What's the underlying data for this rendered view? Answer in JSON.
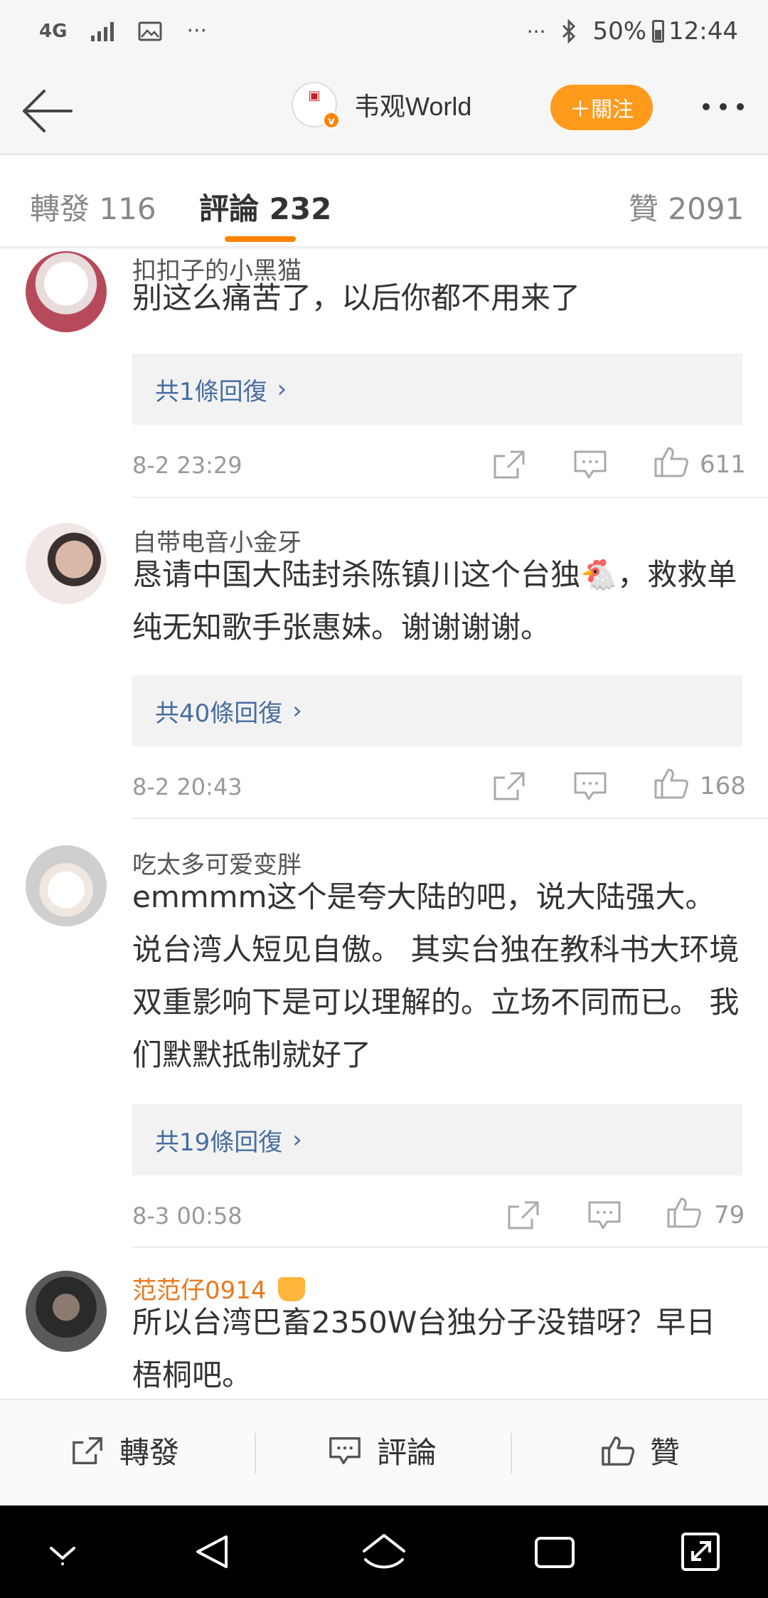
{
  "status_bar": {
    "network": "4G",
    "battery": "50%",
    "time": "12:44",
    "more_left": "···",
    "more_right": "···"
  },
  "header": {
    "account_name": "韦观World",
    "follow_label": "＋關注"
  },
  "tabs": [
    {
      "label": "轉發",
      "count": "116"
    },
    {
      "label": "評論",
      "count": "232"
    },
    {
      "label": "贊",
      "count": "2091"
    }
  ],
  "comments": [
    {
      "user": "扣扣子的小黑猫",
      "text": "别这么痛苦了，以后你都不用来了",
      "replies": "共1條回復",
      "time": "8-2 23:29",
      "likes": "611"
    },
    {
      "user": "自带电音小金牙",
      "text": "恳请中国大陆封杀陈镇川这个台独🐔，救救单纯无知歌手张惠妹。谢谢谢谢。",
      "replies": "共40條回復",
      "time": "8-2 20:43",
      "likes": "168"
    },
    {
      "user": "吃太多可爱变胖",
      "text": "emmmm这个是夸大陆的吧，说大陆强大。说台湾人短见自傲。 其实台独在教科书大环境双重影响下是可以理解的。立场不同而已。 我们默默抵制就好了",
      "replies": "共19條回復",
      "time": "8-3 00:58",
      "likes": "79"
    },
    {
      "user": "范范仔0914",
      "text": "所以台湾巴畜2350W台独分子没错呀？早日梧桐吧。"
    }
  ],
  "bottom_bar": {
    "repost": "轉發",
    "comment": "評論",
    "like": "贊"
  },
  "colors": {
    "accent": "#ff8200",
    "follow_bg": "#ff9a1c",
    "link": "#476da1",
    "vip_name": "#e9781f"
  }
}
